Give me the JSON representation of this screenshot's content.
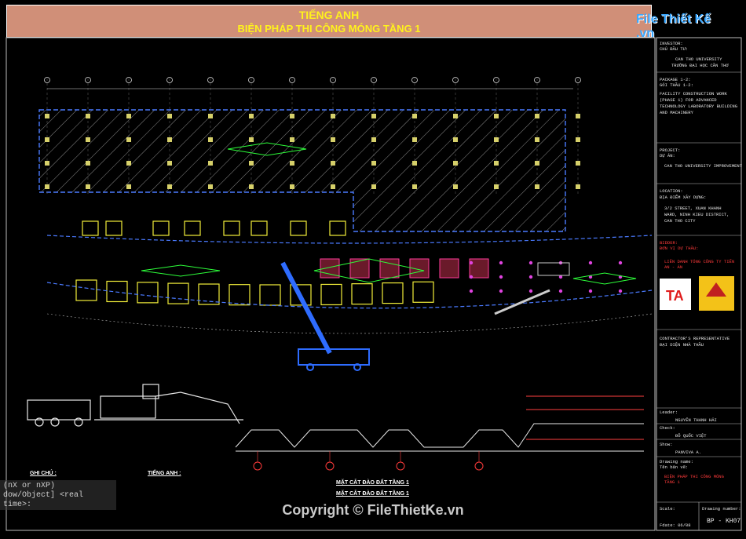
{
  "title": {
    "line1": "TIẾNG ANH",
    "line2": "BIỆN PHÁP THI CÔNG MÓNG TẦNG 1"
  },
  "logo": {
    "text": "File Thiết Kế .vn"
  },
  "panel": {
    "investor_label": "INVESTOR:",
    "investor_label_vi": "CHỦ ĐẦU TƯ:",
    "investor_value": "CAN THO UNIVERSITY",
    "investor_value_vi": "TRƯỜNG ĐẠI HỌC CẦN THƠ",
    "package_label": "PACKAGE 1-2:",
    "package_label_vi": "GÓI THẦU 1-2:",
    "package_value": "FACILITY CONSTRUCTION WORK (PHASE 1) FOR ADVANCED TECHNOLOGY LABORATORY BUILDING AND MACHINERY",
    "project_label": "PROJECT:",
    "project_label_vi": "DỰ ÁN:",
    "project_value": "CAN THO UNIVERSITY IMPROVEMENT",
    "location_label": "LOCATION:",
    "location_label_vi": "ĐỊA ĐIỂM XÂY DỰNG:",
    "location_value": "3/2 STREET, XUAN KHANH WARD, NINH KIEU DISTRICT, CAN THO CITY",
    "bidder_label": "BIDDER:",
    "bidder_label_vi": "ĐƠN VỊ DỰ THẦU:",
    "bidder_value": "LIÊN DANH TỔNG CÔNG TY TIẾN AN - ÁN",
    "contractor_label": "CONTRACTOR'S REPRESENTATIVE",
    "contractor_label_vi": "ĐẠI DIỆN NHÀ THẦU",
    "leader_label": "Leader:",
    "leader_value": "NGUYỄN THANH HẢI",
    "check_label": "Check:",
    "check_value": "ĐỖ QUỐC VIỆT",
    "show_label": "Show:",
    "show_value": "PANVIVA A.",
    "drawing_name_label": "Drawing name:",
    "drawing_name_label_vi": "Tên bản vẽ:",
    "drawing_name_value": "BIỆN PHÁP THI CÔNG MÓNG TẦNG 1",
    "scale_label": "Scale:",
    "drawing_number_label": "Drawing number:",
    "drawing_number_value": "BP - KH07",
    "date_value": "Fdate: 06/08"
  },
  "annotations": {
    "notes_vi": "GHI CHÚ :",
    "notes_en": "TIẾNG ANH :",
    "section1": "MẶT CẮT ĐÀO ĐẤT TẦNG 1",
    "section2": "MẶT CẮT ĐÀO ĐẤT TẦNG 1"
  },
  "command_line": {
    "line1": "(nX or nXP)",
    "line2": "dow/Object] <real time>:"
  },
  "copyright": "Copyright © FileThietKe.vn"
}
